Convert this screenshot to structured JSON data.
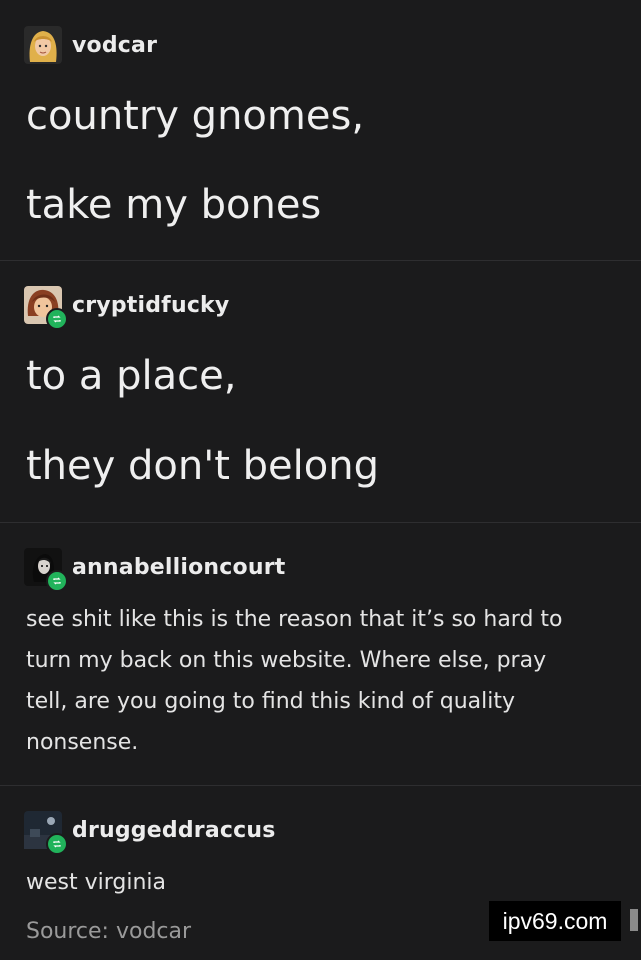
{
  "posts": [
    {
      "username": "vodcar",
      "lines": [
        "country gnomes,",
        "take my bones"
      ],
      "avatar_icon": "blonde-character-avatar",
      "reblog": false
    },
    {
      "username": "cryptidfucky",
      "lines": [
        "to a place,",
        "they don't belong"
      ],
      "avatar_icon": "redhead-character-avatar",
      "reblog": true
    },
    {
      "username": "annabellioncourt",
      "text_lines": [
        "see shit like this is the reason that it’s so hard to",
        "turn my back on this website. Where else, pray",
        "tell, are you going to find this kind of quality",
        "nonsense."
      ],
      "avatar_icon": "dark-character-avatar",
      "reblog": true
    },
    {
      "username": "druggeddraccus",
      "text_lines": [
        "west virginia"
      ],
      "avatar_icon": "night-scene-avatar",
      "reblog": true
    }
  ],
  "source": "Source: vodcar",
  "watermark": "ipv69.com",
  "colors": {
    "background": "#1b1b1c",
    "reblog_green": "#21b35b",
    "text": "#e8e8e8",
    "muted": "#9a9a9a"
  }
}
